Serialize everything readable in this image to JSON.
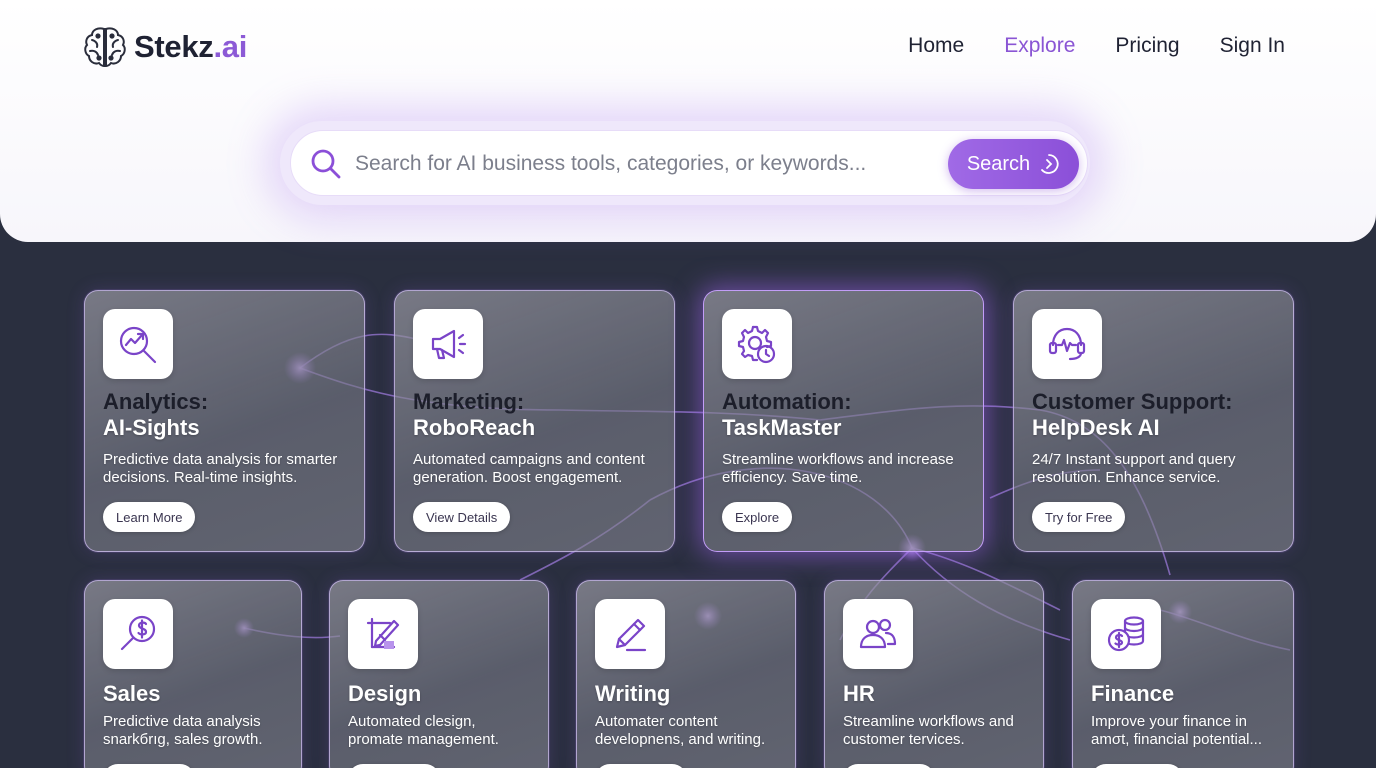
{
  "brand": {
    "name_main": "Stekz",
    "name_suffix": ".ai",
    "logo_icon": "brain-icon"
  },
  "nav": {
    "items": [
      {
        "label": "Home",
        "active": false
      },
      {
        "label": "Explore",
        "active": true
      },
      {
        "label": "Pricing",
        "active": false
      },
      {
        "label": "Sign In",
        "active": false
      }
    ]
  },
  "search": {
    "placeholder": "Search for AI business tools, categories, or keywords...",
    "value": "",
    "button_label": "Search"
  },
  "colors": {
    "accent": "#8b4fd8",
    "accent_light": "#a06ae6",
    "background": "#2a2f3f",
    "header": "#ffffff"
  },
  "cards_top": [
    {
      "icon": "analytics-magnifier-icon",
      "title_line1": "Analytics:",
      "title_line2": "AI-Sights",
      "desc_line1": "Predictive data analysis for smarter",
      "desc_line2": "decisions. Real-time insights.",
      "button": "Learn More"
    },
    {
      "icon": "megaphone-icon",
      "title_line1": "Marketing:",
      "title_line2": "RoboReach",
      "desc_line1": "Automated campaigns and content",
      "desc_line2": "generation. Boost engagement.",
      "button": "View Details"
    },
    {
      "icon": "gear-clock-icon",
      "title_line1": "Automation:",
      "title_line2": "TaskMaster",
      "desc_line1": "Streamline workflows and increase",
      "desc_line2": "efficiency. Save time.",
      "button": "Explore"
    },
    {
      "icon": "headset-icon",
      "title_line1": "Customer Support:",
      "title_line2": "HelpDesk AI",
      "desc_line1": "24/7 Instant support and query",
      "desc_line2": "resolution. Enhance service.",
      "button": "Try for Free"
    }
  ],
  "cards_bottom": [
    {
      "icon": "dollar-magnifier-icon",
      "title": "Sales",
      "desc_line1": "Predictive data analysis",
      "desc_line2": "snarkбrıg, sales growth."
    },
    {
      "icon": "design-pencil-icon",
      "title": "Design",
      "desc_line1": "Automated clesign,",
      "desc_line2": "promate management."
    },
    {
      "icon": "pencil-icon",
      "title": "Writing",
      "desc_line1": "Automater content",
      "desc_line2": "developnens, and writing."
    },
    {
      "icon": "people-icon",
      "title": "HR",
      "desc_line1": "Streamline workflows and",
      "desc_line2": "customer tervices."
    },
    {
      "icon": "coins-icon",
      "title": "Finance",
      "desc_line1": "Improve your finance in",
      "desc_line2": "amσt, financial potential..."
    }
  ]
}
